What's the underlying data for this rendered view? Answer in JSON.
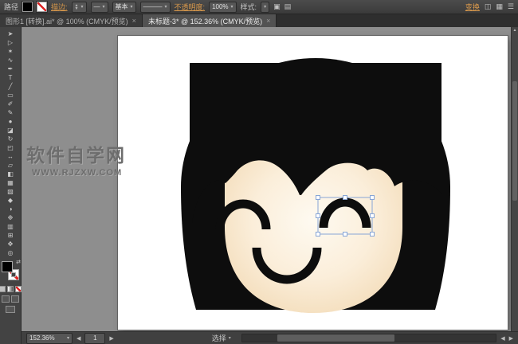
{
  "control_bar": {
    "object_label": "路径",
    "stroke_label": "描边:",
    "brush_value": "基本",
    "opacity_label": "不透明度:",
    "opacity_value": "100%",
    "style_label": "样式:",
    "transform_label": "变换"
  },
  "ui": {
    "dropdown": "▾",
    "up": "▲",
    "down": "▼",
    "left": "◀",
    "right": "▶",
    "line": "———",
    "short_line": "—",
    "menu": "☰",
    "close": "×",
    "swap": "⇄",
    "doc_icon1": "▣",
    "doc_icon2": "▤",
    "panel_icon1": "◫",
    "panel_icon2": "▦"
  },
  "tabs": [
    {
      "label": "图形1 [转换].ai* @ 100% (CMYK/预览)",
      "active": false
    },
    {
      "label": "未标题-3* @ 152.36% (CMYK/预览)",
      "active": true
    }
  ],
  "toolbar": {
    "tools": [
      {
        "name": "selection-tool",
        "glyph": "➤"
      },
      {
        "name": "direct-selection-tool",
        "glyph": "▷"
      },
      {
        "name": "magic-wand-tool",
        "glyph": "✶"
      },
      {
        "name": "lasso-tool",
        "glyph": "∿"
      },
      {
        "name": "pen-tool",
        "glyph": "✒"
      },
      {
        "name": "type-tool",
        "glyph": "T"
      },
      {
        "name": "line-segment-tool",
        "glyph": "╱"
      },
      {
        "name": "rectangle-tool",
        "glyph": "▭"
      },
      {
        "name": "paintbrush-tool",
        "glyph": "✐"
      },
      {
        "name": "pencil-tool",
        "glyph": "✎"
      },
      {
        "name": "blob-brush-tool",
        "glyph": "●"
      },
      {
        "name": "eraser-tool",
        "glyph": "◪"
      },
      {
        "name": "rotate-tool",
        "glyph": "↻"
      },
      {
        "name": "scale-tool",
        "glyph": "◰"
      },
      {
        "name": "width-tool",
        "glyph": "↔"
      },
      {
        "name": "free-transform-tool",
        "glyph": "▱"
      },
      {
        "name": "shape-builder-tool",
        "glyph": "◧"
      },
      {
        "name": "mesh-tool",
        "glyph": "▦"
      },
      {
        "name": "gradient-tool",
        "glyph": "▧"
      },
      {
        "name": "eyedropper-tool",
        "glyph": "◆"
      },
      {
        "name": "blend-tool",
        "glyph": "◑"
      },
      {
        "name": "symbol-sprayer-tool",
        "glyph": "❉"
      },
      {
        "name": "column-graph-tool",
        "glyph": "▥"
      },
      {
        "name": "artboard-tool",
        "glyph": "⊞"
      },
      {
        "name": "hand-tool",
        "glyph": "✥"
      },
      {
        "name": "zoom-tool",
        "glyph": "◎"
      }
    ]
  },
  "pasteboard": {
    "watermark_title": "软件自学网",
    "watermark_url": "WWW.RJZXW.COM"
  },
  "artwork": {
    "hair_color": "#0d0d0d",
    "line_color": "#0d0d0d",
    "skin_center": "#fefaf1",
    "skin_mid": "#fbeeda",
    "skin_edge": "#f3dcb9",
    "selection_color": "#87a5d6",
    "handle_fill": "#ffffff"
  },
  "status_bar": {
    "zoom_value": "152.36%",
    "artboard_value": "1",
    "status_text": "选择"
  }
}
